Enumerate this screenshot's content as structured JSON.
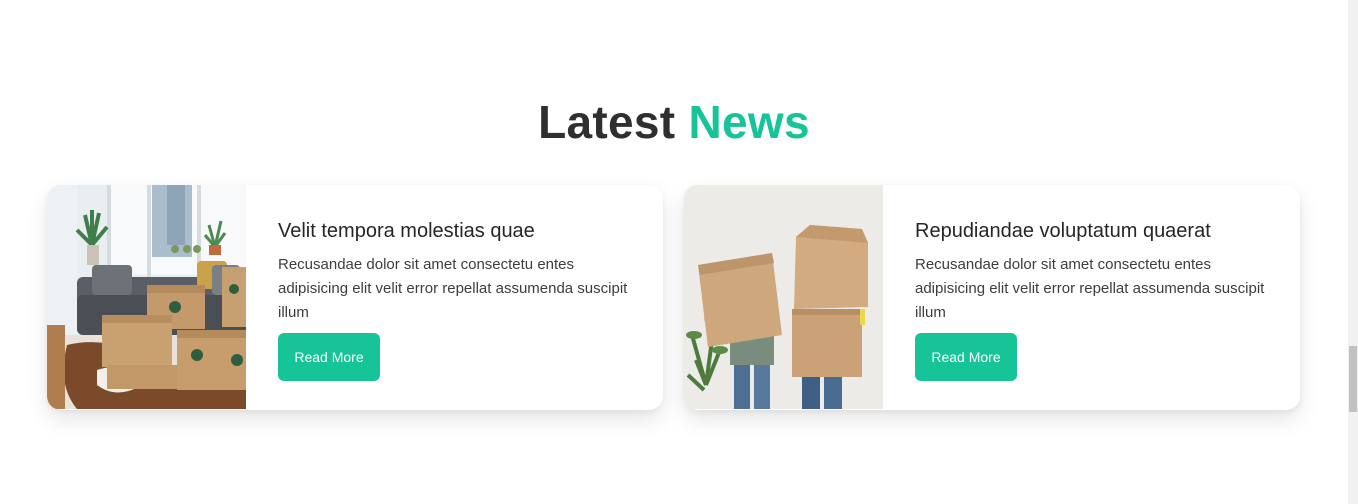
{
  "section": {
    "title_main": "Latest",
    "title_accent": "News",
    "accent_color": "#16c497"
  },
  "cards": [
    {
      "title": "Velit tempora molestias quae",
      "text": "Recusandae dolor sit amet consectetu entes adipisicing elit velit error repellat assumenda suscipit illum",
      "button_label": "Read More",
      "image": "moving-boxes-living-room-photo"
    },
    {
      "title": "Repudiandae voluptatum quaerat",
      "text": "Recusandae dolor sit amet consectetu entes adipisicing elit velit error repellat assumenda suscipit illum",
      "button_label": "Read More",
      "image": "people-carrying-boxes-photo"
    }
  ]
}
